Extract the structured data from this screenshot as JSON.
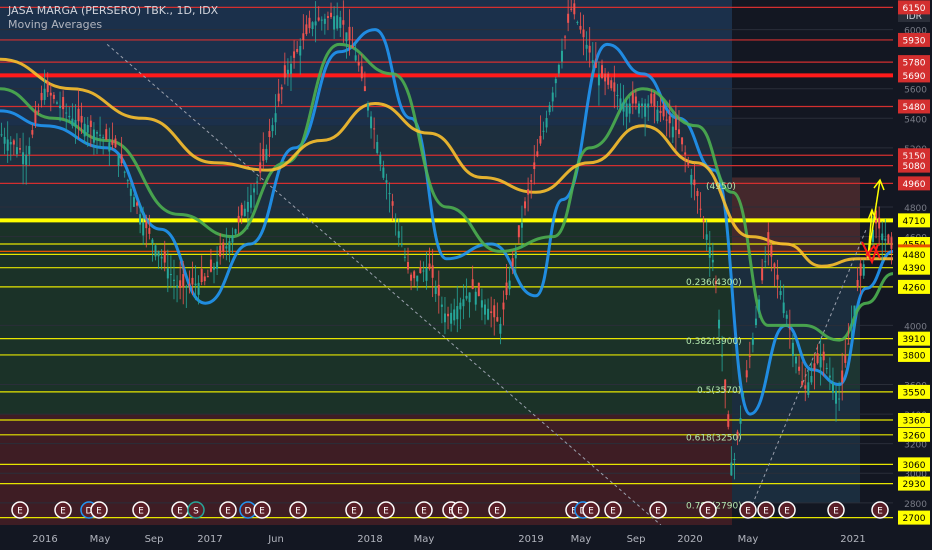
{
  "header": {
    "title": "JASA MARGA (PERSERO) TBK., 1D, IDX",
    "indicator": "Moving Averages"
  },
  "chart_data": {
    "type": "line",
    "currency": "IDR",
    "x_ticks": [
      "2016",
      "May",
      "Sep",
      "2017",
      "Jun",
      "2018",
      "May",
      "2019",
      "May",
      "Sep",
      "2020",
      "May",
      "2021"
    ],
    "y_ticks": [
      6000,
      5600,
      5400,
      5200,
      4800,
      4600,
      4000,
      3600,
      3400,
      3200,
      3000,
      2800
    ],
    "ylim": [
      2650,
      6200
    ],
    "price_levels": [
      {
        "value": 6150,
        "color": "#d32f2f"
      },
      {
        "value": 5930,
        "color": "#d32f2f"
      },
      {
        "value": 5780,
        "color": "#d32f2f"
      },
      {
        "value": 5690,
        "color": "#ff1a1a",
        "bold": true
      },
      {
        "value": 5480,
        "color": "#d32f2f"
      },
      {
        "value": 5150,
        "color": "#d32f2f"
      },
      {
        "value": 5080,
        "color": "#d32f2f"
      },
      {
        "value": 4960,
        "color": "#d32f2f"
      },
      {
        "value": 4710,
        "color": "#ffff00",
        "bold": true
      },
      {
        "value": 4550,
        "color": "#e6e600"
      },
      {
        "value": 4500,
        "color": "#e65100"
      },
      {
        "value": 4480,
        "color": "#e6e600"
      },
      {
        "value": 4390,
        "color": "#e6e600"
      },
      {
        "value": 4260,
        "color": "#e6e600"
      },
      {
        "value": 3910,
        "color": "#e6e600"
      },
      {
        "value": 3800,
        "color": "#e6e600"
      },
      {
        "value": 3550,
        "color": "#e6e600"
      },
      {
        "value": 3360,
        "color": "#e6e600"
      },
      {
        "value": 3260,
        "color": "#e6e600"
      },
      {
        "value": 3060,
        "color": "#e6e600"
      },
      {
        "value": 2930,
        "color": "#e6e600"
      },
      {
        "value": 2700,
        "color": "#e6e600"
      }
    ],
    "fib_levels": [
      {
        "label": "0.236(4300)",
        "value": 4300
      },
      {
        "label": "0.382(3900)",
        "value": 3900
      },
      {
        "label": "0.5(3570)",
        "value": 3570
      },
      {
        "label": "0.618(3250)",
        "value": 3250
      },
      {
        "label": "0.786(2790)",
        "value": 2790
      },
      {
        "label": "(4950)",
        "value": 4950
      }
    ],
    "events": [
      "E",
      "E",
      "D",
      "E",
      "E",
      "E",
      "S",
      "E",
      "D",
      "E",
      "E",
      "E",
      "E",
      "E",
      "E",
      "E",
      "E",
      "E",
      "D",
      "E",
      "E",
      "E",
      "E",
      "E",
      "E",
      "E",
      "E",
      "E"
    ],
    "ma_series": [
      {
        "color": "#2196f3",
        "x": [
          0,
          0.05,
          0.12,
          0.18,
          0.23,
          0.28,
          0.33,
          0.38,
          0.42,
          0.46,
          0.5,
          0.55,
          0.6,
          0.63,
          0.68,
          0.72,
          0.76,
          0.8,
          0.84,
          0.88,
          0.91,
          0.94,
          0.97,
          1.0
        ],
        "y": [
          5450,
          5350,
          5200,
          4650,
          4150,
          4550,
          5200,
          5850,
          6000,
          5400,
          4450,
          4550,
          4200,
          4850,
          5900,
          5700,
          5400,
          5050,
          3400,
          4000,
          3700,
          3600,
          4250,
          4500
        ]
      },
      {
        "color": "#4caf50",
        "x": [
          0,
          0.06,
          0.12,
          0.2,
          0.26,
          0.32,
          0.38,
          0.44,
          0.5,
          0.56,
          0.62,
          0.66,
          0.72,
          0.78,
          0.82,
          0.86,
          0.9,
          0.94,
          0.97,
          1.0
        ],
        "y": [
          5600,
          5400,
          5250,
          4750,
          4600,
          5100,
          5900,
          5700,
          4800,
          4500,
          4600,
          5200,
          5600,
          5350,
          4900,
          4000,
          4000,
          3900,
          4150,
          4350
        ]
      },
      {
        "color": "#fbc02d",
        "x": [
          0,
          0.08,
          0.16,
          0.24,
          0.3,
          0.36,
          0.42,
          0.48,
          0.54,
          0.6,
          0.66,
          0.72,
          0.78,
          0.84,
          0.88,
          0.92,
          0.96,
          1.0
        ],
        "y": [
          5800,
          5600,
          5400,
          5100,
          5050,
          5250,
          5500,
          5300,
          5000,
          4900,
          5100,
          5350,
          5100,
          4600,
          4550,
          4400,
          4450,
          4450
        ]
      }
    ],
    "price_path": {
      "x": [
        0,
        0.03,
        0.05,
        0.08,
        0.1,
        0.13,
        0.16,
        0.2,
        0.23,
        0.26,
        0.29,
        0.32,
        0.35,
        0.38,
        0.4,
        0.43,
        0.46,
        0.48,
        0.5,
        0.53,
        0.56,
        0.59,
        0.62,
        0.64,
        0.67,
        0.7,
        0.73,
        0.76,
        0.78,
        0.8,
        0.82,
        0.84,
        0.86,
        0.88,
        0.9,
        0.92,
        0.94,
        0.96,
        0.98,
        1.0
      ],
      "y": [
        5300,
        5150,
        5600,
        5400,
        5350,
        5200,
        4700,
        4250,
        4300,
        4600,
        5000,
        5700,
        6050,
        6100,
        5800,
        5050,
        4300,
        4400,
        4050,
        4250,
        4000,
        4850,
        5600,
        6150,
        5700,
        5500,
        5500,
        5300,
        4900,
        4400,
        3000,
        3800,
        4550,
        4100,
        3550,
        3800,
        3500,
        4250,
        4700,
        4500
      ]
    }
  }
}
